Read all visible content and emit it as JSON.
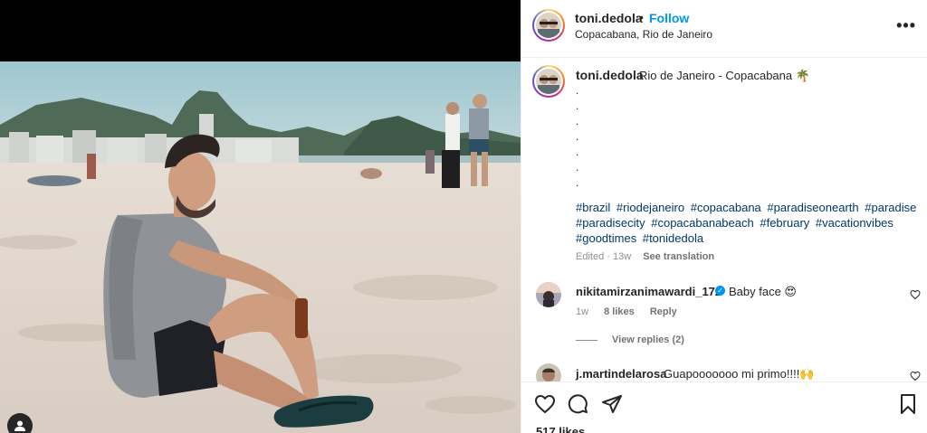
{
  "post": {
    "username": "toni.dedola",
    "follow_label": "Follow",
    "separator": "•",
    "location": "Copacabana, Rio de Janeiro",
    "more_label": "•••"
  },
  "caption": {
    "username": "toni.dedola",
    "text": "Rio de Janeiro - Copacabana 🌴",
    "dots": [
      ".",
      ".",
      ".",
      ".",
      ".",
      ".",
      "."
    ],
    "hashtags": [
      "#brazil",
      "#riodejaneiro",
      "#copacabana",
      "#paradiseonearth",
      "#paradise",
      "#paradisecity",
      "#copacabanabeach",
      "#february",
      "#vacationvibes",
      "#goodtimes",
      "#tonidedola"
    ],
    "edited": "Edited · 13w",
    "see_translation": "See translation"
  },
  "comments": [
    {
      "username": "nikitamirzanimawardi_172",
      "verified": "✓",
      "text": "Baby face 😍",
      "age": "1w",
      "likes": "8 likes",
      "reply": "Reply",
      "view_replies": "View replies (2)"
    },
    {
      "username": "j.martindelarosa",
      "text": "Guapooooooo mi primo!!!!🙌"
    }
  ],
  "likes_label": "517 likes",
  "icons": [
    "like-icon",
    "comment-icon",
    "share-icon",
    "save-icon",
    "tag-user-icon",
    "more-icon"
  ]
}
